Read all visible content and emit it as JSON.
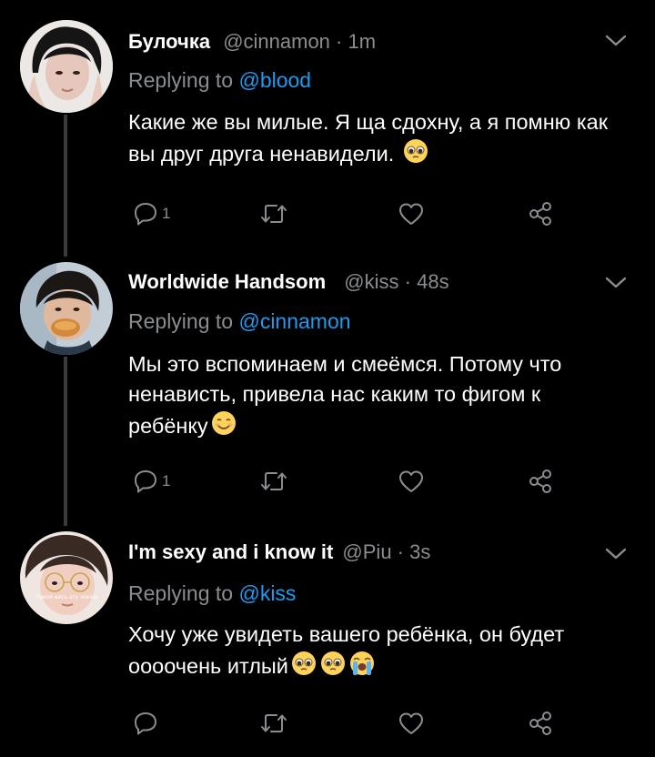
{
  "tweets": [
    {
      "name": "Булочка",
      "handle": "@cinnamon",
      "time": "1m",
      "replying_label": "Replying to",
      "replying_to": "@blood",
      "text": "Какие же вы милые. Я ща сдохну, а я помню как вы друг друга ненавидели.",
      "emoji": [
        "pleading-face"
      ],
      "reply_count": "1"
    },
    {
      "name": "Worldwide Handsom",
      "handle": "@kiss",
      "time": "48s",
      "replying_label": "Replying to",
      "replying_to": "@cinnamon",
      "text": "Мы это вспоминаем и смеёмся. Потому что ненависть, привела нас каким то фигом к ребёнку",
      "emoji": [
        "smiling-face"
      ],
      "reply_count": "1"
    },
    {
      "name": "I'm sexy and i know it",
      "handle": "@Piu",
      "time": "3s",
      "replying_label": "Replying to",
      "replying_to": "@kiss",
      "text": "Хочу уже увидеть вашего ребёнка, он будет оооочень итлый",
      "emoji": [
        "pleading-face",
        "pleading-face",
        "loudly-crying-face"
      ],
      "reply_count": "",
      "avatar_caption": "такой весь эту жизнь"
    }
  ],
  "separator": " · ",
  "colors": {
    "background": "#000000",
    "secondary_text": "#8a8d91",
    "link": "#1d9bf0",
    "thread_line": "#3a3a3a"
  }
}
